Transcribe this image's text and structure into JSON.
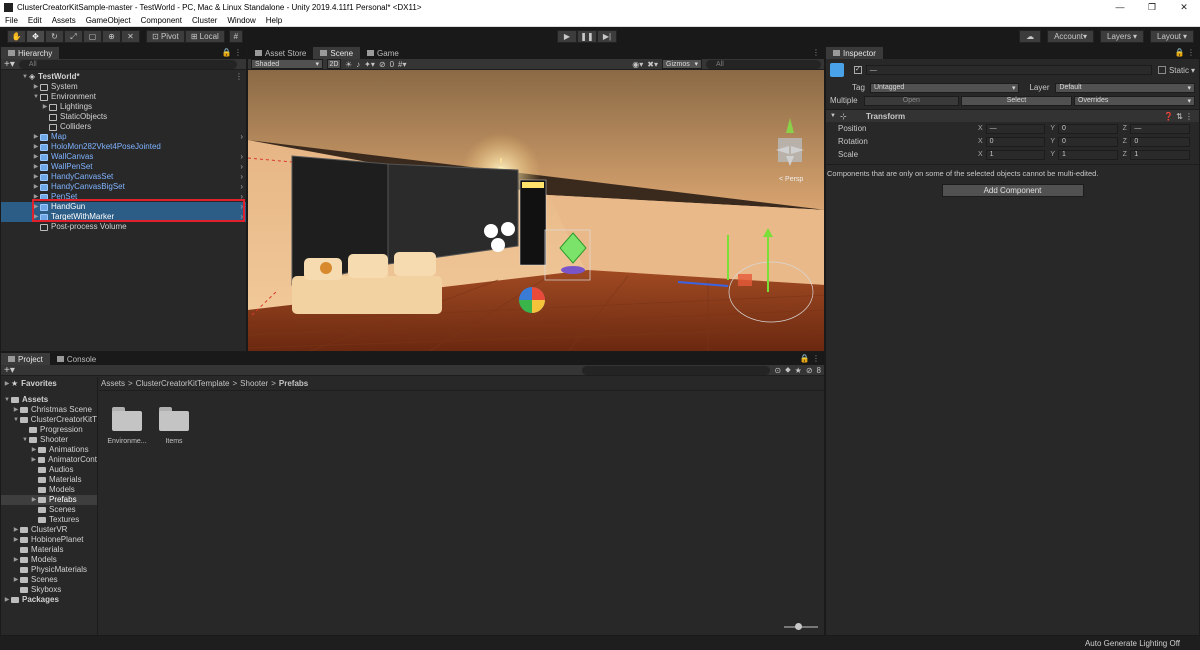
{
  "window": {
    "title": "ClusterCreatorKitSample-master - TestWorld - PC, Mac & Linux Standalone - Unity 2019.4.11f1 Personal* <DX11>",
    "controls": [
      "—",
      "❐",
      "✕"
    ]
  },
  "menu": [
    "File",
    "Edit",
    "Assets",
    "GameObject",
    "Component",
    "Cluster",
    "Window",
    "Help"
  ],
  "toolbar": {
    "pivot": "Pivot",
    "local": "Local",
    "account": "Account",
    "layers": "Layers",
    "layout": "Layout"
  },
  "hierarchy": {
    "tab": "Hierarchy",
    "search_placeholder": "All",
    "scene": "TestWorld*",
    "rows": [
      {
        "label": "System",
        "depth": 1,
        "arrow": "▶",
        "type": "go",
        "selected": false,
        "chevron": false
      },
      {
        "label": "Environment",
        "depth": 1,
        "arrow": "▼",
        "type": "go",
        "selected": false,
        "chevron": false
      },
      {
        "label": "Lightings",
        "depth": 2,
        "arrow": "▶",
        "type": "go",
        "selected": false,
        "chevron": false
      },
      {
        "label": "StaticObjects",
        "depth": 2,
        "arrow": "",
        "type": "go",
        "selected": false,
        "chevron": false
      },
      {
        "label": "Colliders",
        "depth": 2,
        "arrow": "",
        "type": "go",
        "selected": false,
        "chevron": false
      },
      {
        "label": "Map",
        "depth": 1,
        "arrow": "▶",
        "type": "prefab",
        "selected": false,
        "chevron": true
      },
      {
        "label": "HoloMon282Vket4PoseJointed",
        "depth": 1,
        "arrow": "▶",
        "type": "prefab",
        "selected": false,
        "chevron": false
      },
      {
        "label": "WallCanvas",
        "depth": 1,
        "arrow": "▶",
        "type": "prefab",
        "selected": false,
        "chevron": true
      },
      {
        "label": "WallPenSet",
        "depth": 1,
        "arrow": "▶",
        "type": "prefab",
        "selected": false,
        "chevron": true
      },
      {
        "label": "HandyCanvasSet",
        "depth": 1,
        "arrow": "▶",
        "type": "prefab",
        "selected": false,
        "chevron": true
      },
      {
        "label": "HandyCanvasBigSet",
        "depth": 1,
        "arrow": "▶",
        "type": "prefab",
        "selected": false,
        "chevron": true
      },
      {
        "label": "PenSet",
        "depth": 1,
        "arrow": "▶",
        "type": "prefab",
        "selected": false,
        "chevron": true
      },
      {
        "label": "HandGun",
        "depth": 1,
        "arrow": "▶",
        "type": "prefab",
        "selected": true,
        "chevron": true
      },
      {
        "label": "TargetWithMarker",
        "depth": 1,
        "arrow": "▶",
        "type": "prefab",
        "selected": true,
        "chevron": true
      },
      {
        "label": "Post-process Volume",
        "depth": 1,
        "arrow": "",
        "type": "go",
        "selected": false,
        "chevron": false
      }
    ]
  },
  "scene": {
    "tabs": [
      "Asset Store",
      "Scene",
      "Game"
    ],
    "shading": "Shaded",
    "mode2d": "2D",
    "gizmos": "Gizmos",
    "search_placeholder": "All",
    "persp": "< Persp",
    "effects_count": "0"
  },
  "project": {
    "tabs": [
      "Project",
      "Console"
    ],
    "badge_count": "8",
    "favorites": "Favorites",
    "tree": [
      {
        "label": "Assets",
        "depth": 0,
        "arrow": "▼",
        "bold": true,
        "selected": false
      },
      {
        "label": "Christmas Scene",
        "depth": 1,
        "arrow": "▶",
        "bold": false,
        "selected": false
      },
      {
        "label": "ClusterCreatorKitT",
        "depth": 1,
        "arrow": "▼",
        "bold": false,
        "selected": false
      },
      {
        "label": "Progression",
        "depth": 2,
        "arrow": "",
        "bold": false,
        "selected": false
      },
      {
        "label": "Shooter",
        "depth": 2,
        "arrow": "▼",
        "bold": false,
        "selected": false
      },
      {
        "label": "Animations",
        "depth": 3,
        "arrow": "▶",
        "bold": false,
        "selected": false
      },
      {
        "label": "AnimatorCont",
        "depth": 3,
        "arrow": "▶",
        "bold": false,
        "selected": false
      },
      {
        "label": "Audios",
        "depth": 3,
        "arrow": "",
        "bold": false,
        "selected": false
      },
      {
        "label": "Materials",
        "depth": 3,
        "arrow": "",
        "bold": false,
        "selected": false
      },
      {
        "label": "Models",
        "depth": 3,
        "arrow": "",
        "bold": false,
        "selected": false
      },
      {
        "label": "Prefabs",
        "depth": 3,
        "arrow": "▶",
        "bold": false,
        "selected": true
      },
      {
        "label": "Scenes",
        "depth": 3,
        "arrow": "",
        "bold": false,
        "selected": false
      },
      {
        "label": "Textures",
        "depth": 3,
        "arrow": "",
        "bold": false,
        "selected": false
      },
      {
        "label": "ClusterVR",
        "depth": 1,
        "arrow": "▶",
        "bold": false,
        "selected": false
      },
      {
        "label": "HobionePlanet",
        "depth": 1,
        "arrow": "▶",
        "bold": false,
        "selected": false
      },
      {
        "label": "Materials",
        "depth": 1,
        "arrow": "",
        "bold": false,
        "selected": false
      },
      {
        "label": "Models",
        "depth": 1,
        "arrow": "▶",
        "bold": false,
        "selected": false
      },
      {
        "label": "PhysicMaterials",
        "depth": 1,
        "arrow": "",
        "bold": false,
        "selected": false
      },
      {
        "label": "Scenes",
        "depth": 1,
        "arrow": "▶",
        "bold": false,
        "selected": false
      },
      {
        "label": "Skyboxs",
        "depth": 1,
        "arrow": "",
        "bold": false,
        "selected": false
      },
      {
        "label": "Packages",
        "depth": 0,
        "arrow": "▶",
        "bold": true,
        "selected": false
      }
    ],
    "breadcrumb": [
      "Assets",
      "ClusterCreatorKitTemplate",
      "Shooter",
      "Prefabs"
    ],
    "items": [
      {
        "label": "Environme..."
      },
      {
        "label": "Items"
      }
    ]
  },
  "inspector": {
    "tab": "Inspector",
    "name_value": "—",
    "static_label": "Static",
    "tag_label": "Tag",
    "tag_value": "Untagged",
    "layer_label": "Layer",
    "layer_value": "Default",
    "multiple_label": "Multiple",
    "open_label": "Open",
    "select_label": "Select",
    "overrides_label": "Overrides",
    "transform_label": "Transform",
    "rows": [
      {
        "label": "Position",
        "x": "—",
        "y": "0",
        "z": "—"
      },
      {
        "label": "Rotation",
        "x": "0",
        "y": "0",
        "z": "0"
      },
      {
        "label": "Scale",
        "x": "1",
        "y": "1",
        "z": "1"
      }
    ],
    "multi_edit_note": "Components that are only on some of the selected objects cannot be multi-edited.",
    "add_component": "Add Component"
  },
  "status": {
    "text": "Auto Generate Lighting Off"
  }
}
